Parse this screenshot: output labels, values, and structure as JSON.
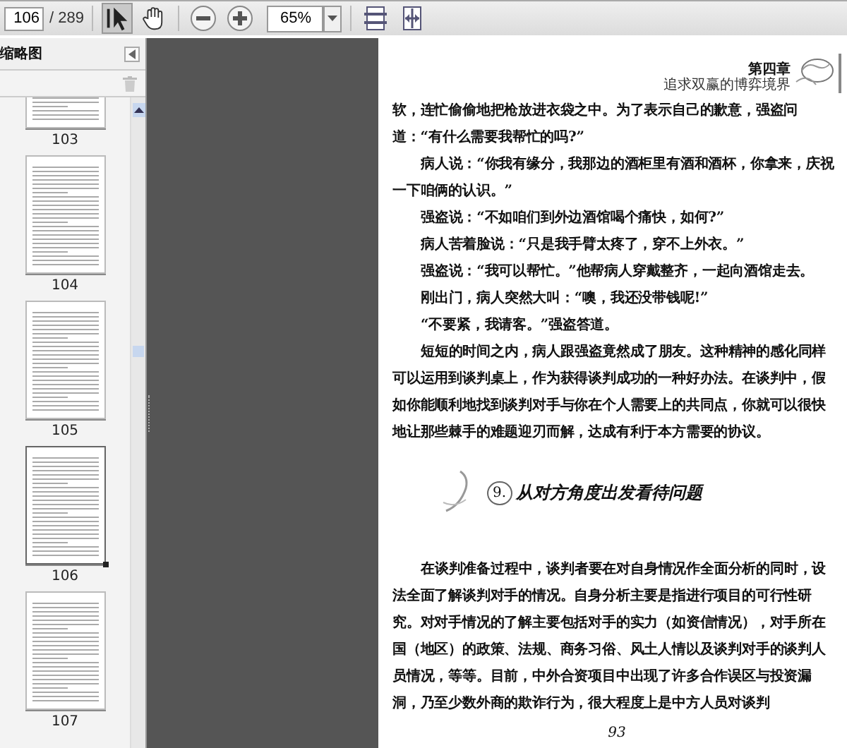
{
  "toolbar": {
    "page_number": "106",
    "page_count": "/ 289",
    "tools": [
      {
        "kind": "select",
        "selected": true
      },
      {
        "kind": "hand",
        "selected": false
      }
    ],
    "zoom": "65%"
  },
  "sidebar": {
    "title": "缩略图",
    "thumbnails": [
      {
        "label": "103",
        "selected": false
      },
      {
        "label": "104",
        "selected": false
      },
      {
        "label": "105",
        "selected": false
      },
      {
        "label": "106",
        "selected": true
      },
      {
        "label": "107",
        "selected": false
      }
    ]
  },
  "document": {
    "chapter": "第四章",
    "chapter_subtitle": "追求双赢的博弈境界",
    "blocks": [
      {
        "kind": "body",
        "text": "软，连忙偷偷地把枪放进衣袋之中。为了表示自己的歉意，强盗问道：“有什么需要我帮忙的吗?”",
        "indent": false
      },
      {
        "kind": "body",
        "text": "病人说：“你我有缘分，我那边的酒柜里有酒和酒杯，你拿来，庆祝一下咱俩的认识。”",
        "indent": true
      },
      {
        "kind": "body",
        "text": "强盗说：“不如咱们到外边酒馆喝个痛快，如何?”",
        "indent": true
      },
      {
        "kind": "body",
        "text": "病人苦着脸说：“只是我手臂太疼了，穿不上外衣。”",
        "indent": true
      },
      {
        "kind": "body",
        "text": "强盗说：“我可以帮忙。”他帮病人穿戴整齐，一起向酒馆走去。",
        "indent": true
      },
      {
        "kind": "body",
        "text": "刚出门，病人突然大叫：“噢，我还没带钱呢!”",
        "indent": true
      },
      {
        "kind": "body",
        "text": "“不要紧，我请客。”强盗答道。",
        "indent": true
      },
      {
        "kind": "body",
        "text": "短短的时间之内，病人跟强盗竟然成了朋友。这种精神的感化同样可以运用到谈判桌上，作为获得谈判成功的一种好办法。在谈判中，假如你能顺利地找到谈判对手与你在个人需要上的共同点，你就可以很快地让那些棘手的难题迎刃而解，达成有利于本方需要的协议。",
        "indent": true
      },
      {
        "kind": "heading",
        "number": "9.",
        "text": "从对方角度出发看待问题"
      },
      {
        "kind": "body",
        "text": "在谈判准备过程中，谈判者要在对自身情况作全面分析的同时，设法全面了解谈判对手的情况。自身分析主要是指进行项目的可行性研究。对对手情况的了解主要包括对手的实力（如资信情况），对手所在国（地区）的政策、法规、商务习俗、风土人情以及谈判对手的谈判人员情况，等等。目前，中外合资项目中出现了许多合作误区与投资漏洞，乃至少数外商的欺诈行为，很大程度上是中方人员对谈判",
        "indent": true
      }
    ],
    "page_number": "93"
  }
}
